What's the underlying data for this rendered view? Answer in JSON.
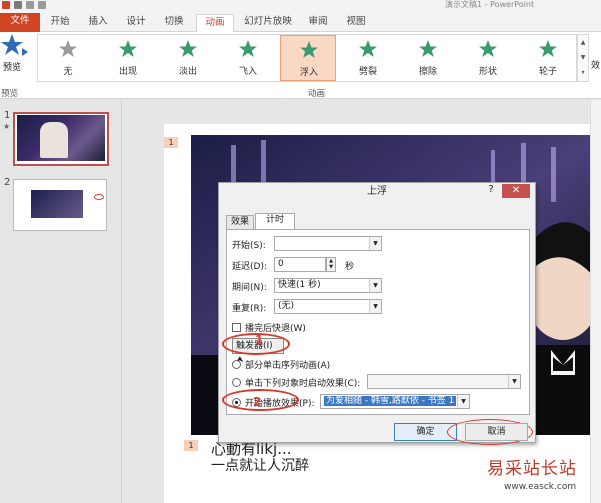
{
  "window": {
    "title": "演示文稿1 - PowerPoint"
  },
  "tabs": [
    "文件",
    "开始",
    "插入",
    "设计",
    "切换",
    "动画",
    "幻灯片放映",
    "审阅",
    "视图"
  ],
  "ribbon": {
    "preview_label": "预览",
    "preview_group": "预览",
    "animation_group": "动画",
    "effects_partial": "效",
    "animations": [
      {
        "label": "无",
        "color": "#9a9a9a"
      },
      {
        "label": "出现",
        "color": "#3a9c6c"
      },
      {
        "label": "淡出",
        "color": "#3a9c6c"
      },
      {
        "label": "飞入",
        "color": "#3a9c6c"
      },
      {
        "label": "浮入",
        "color": "#3a9c6c"
      },
      {
        "label": "劈裂",
        "color": "#3a9c6c"
      },
      {
        "label": "擦除",
        "color": "#3a9c6c"
      },
      {
        "label": "形状",
        "color": "#3a9c6c"
      },
      {
        "label": "轮子",
        "color": "#3a9c6c"
      }
    ],
    "selected_animation": "浮入"
  },
  "slides_pane": {
    "slide_numbers": [
      "1",
      "2"
    ],
    "star_marker": "★"
  },
  "slide": {
    "anim_tag_top": "1",
    "anim_tag_bottom": "1",
    "lyric_line1": "心動有likj...",
    "lyric_line2": "一点就让人沉醉"
  },
  "dialog": {
    "title": "上浮",
    "help": "?",
    "close": "✕",
    "tab_effect": "效果",
    "tab_timing": "计时",
    "start_label": "开始(S):",
    "start_value": "",
    "delay_label": "延迟(D):",
    "delay_value": "0",
    "delay_unit": "秒",
    "duration_label": "期间(N):",
    "duration_value": "快速(1 秒)",
    "repeat_label": "重复(R):",
    "repeat_value": "(无)",
    "rewind_label": "播完后快退(W)",
    "trigger_label": "触发器(I) ⮝",
    "opt_sequence": "部分单击序列动画(A)",
    "opt_click_object": "单击下列对象时启动效果(C):",
    "opt_play_effect": "开始播放效果(P):",
    "play_effect_value": "为爱相随 - 韩雪,路默依 - 书签 1",
    "ok": "确定",
    "cancel": "取消",
    "marker1": "1",
    "marker2": "2"
  },
  "watermark": {
    "name": "易采站长站",
    "url": "www.easck.com"
  }
}
